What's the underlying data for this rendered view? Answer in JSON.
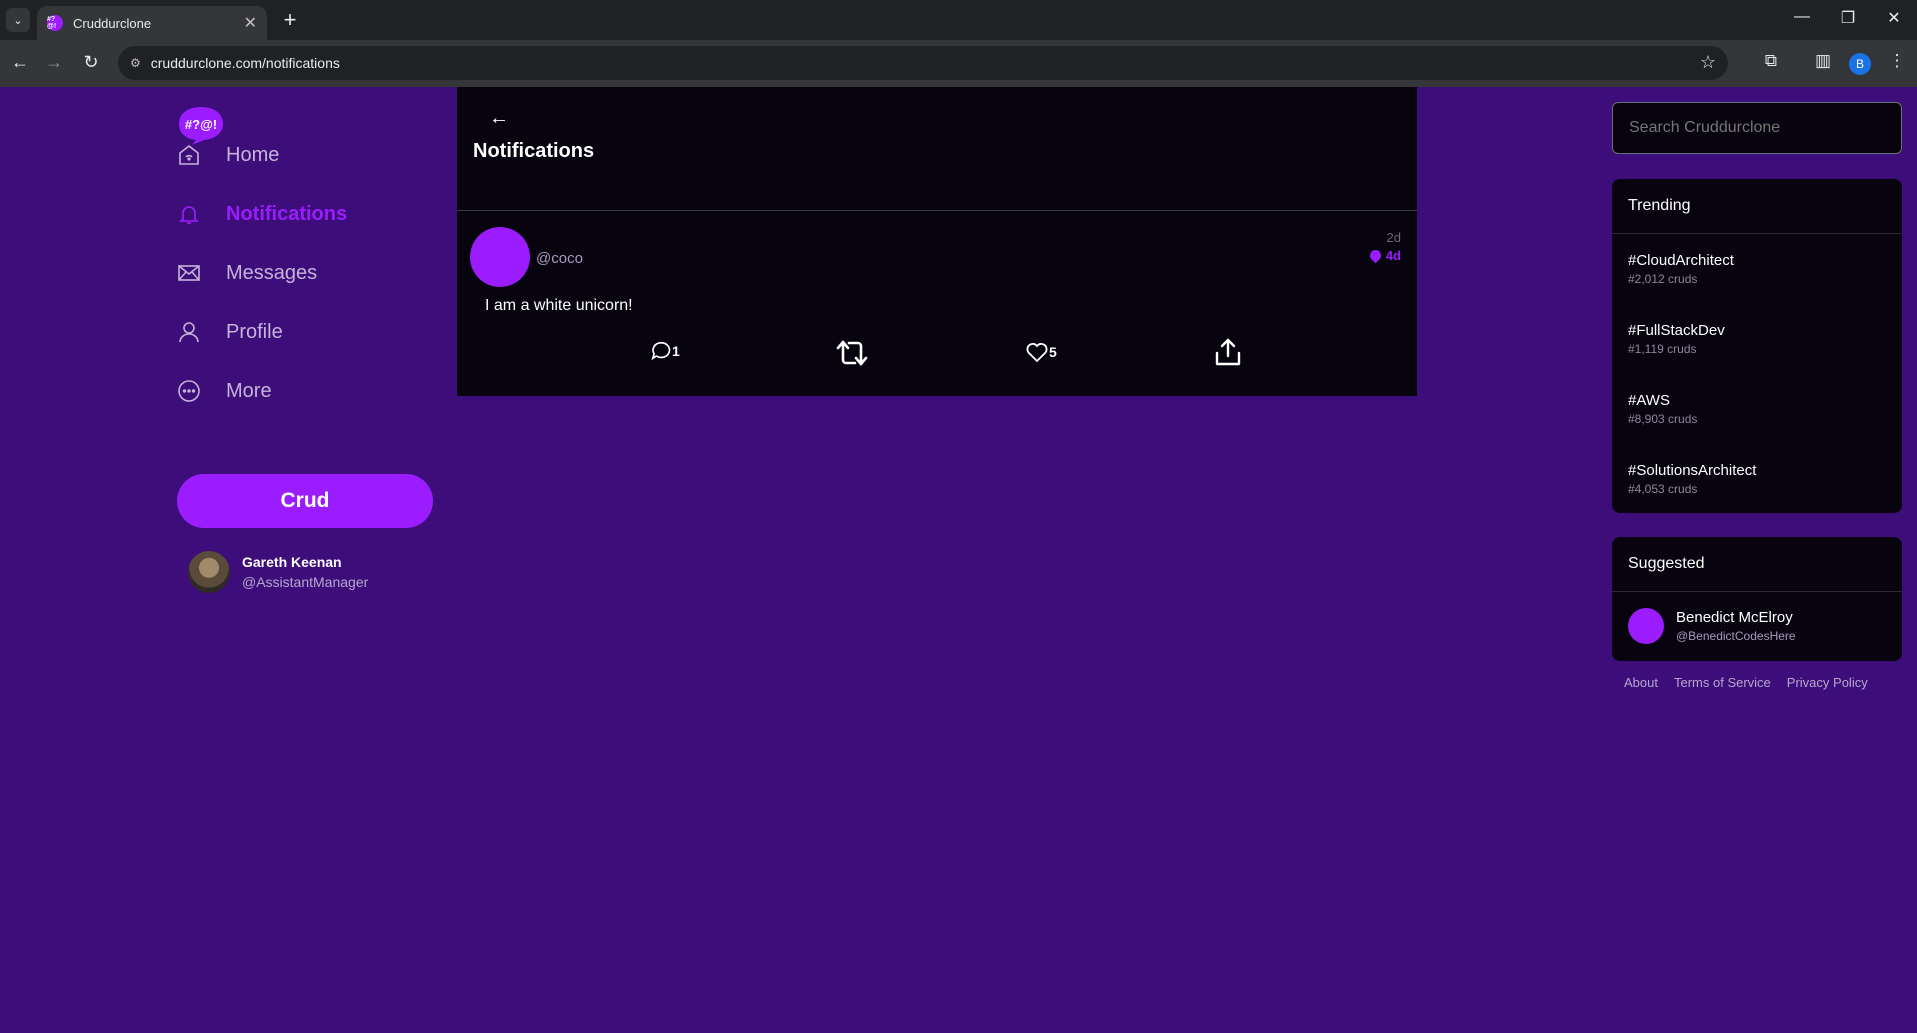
{
  "browser": {
    "tab_title": "Cruddurclone",
    "favicon_text": "#?@!",
    "url": "cruddurclone.com/notifications",
    "profile_initial": "B"
  },
  "logo": {
    "text": "#?@!",
    "color": "#9b1dff"
  },
  "nav": {
    "items": [
      {
        "label": "Home",
        "icon": "home-icon"
      },
      {
        "label": "Notifications",
        "icon": "bell-icon",
        "active": true
      },
      {
        "label": "Messages",
        "icon": "envelope-icon"
      },
      {
        "label": "Profile",
        "icon": "user-icon"
      },
      {
        "label": "More",
        "icon": "more-icon"
      }
    ],
    "crud_button": "Crud"
  },
  "current_user": {
    "name": "Gareth Keenan",
    "handle": "@AssistantManager"
  },
  "feed": {
    "title": "Notifications",
    "back": "←",
    "posts": [
      {
        "handle": "@coco",
        "time_ago": "2d",
        "expires": "4d",
        "text": "I am a white unicorn!",
        "replies": "1",
        "reposts": "",
        "likes": "5"
      }
    ]
  },
  "search": {
    "placeholder": "Search Cruddurclone"
  },
  "trending": {
    "title": "Trending",
    "items": [
      {
        "tag": "#CloudArchitect",
        "count": "#2,012 cruds"
      },
      {
        "tag": "#FullStackDev",
        "count": "#1,119 cruds"
      },
      {
        "tag": "#AWS",
        "count": "#8,903 cruds"
      },
      {
        "tag": "#SolutionsArchitect",
        "count": "#4,053 cruds"
      }
    ]
  },
  "suggested": {
    "title": "Suggested",
    "users": [
      {
        "name": "Benedict McElroy",
        "handle": "@BenedictCodesHere"
      }
    ]
  },
  "footer": {
    "links": [
      "About",
      "Terms of Service",
      "Privacy Policy"
    ]
  },
  "colors": {
    "accent": "#9b1dff",
    "background": "#3d0d7a",
    "panel": "#07030f"
  }
}
